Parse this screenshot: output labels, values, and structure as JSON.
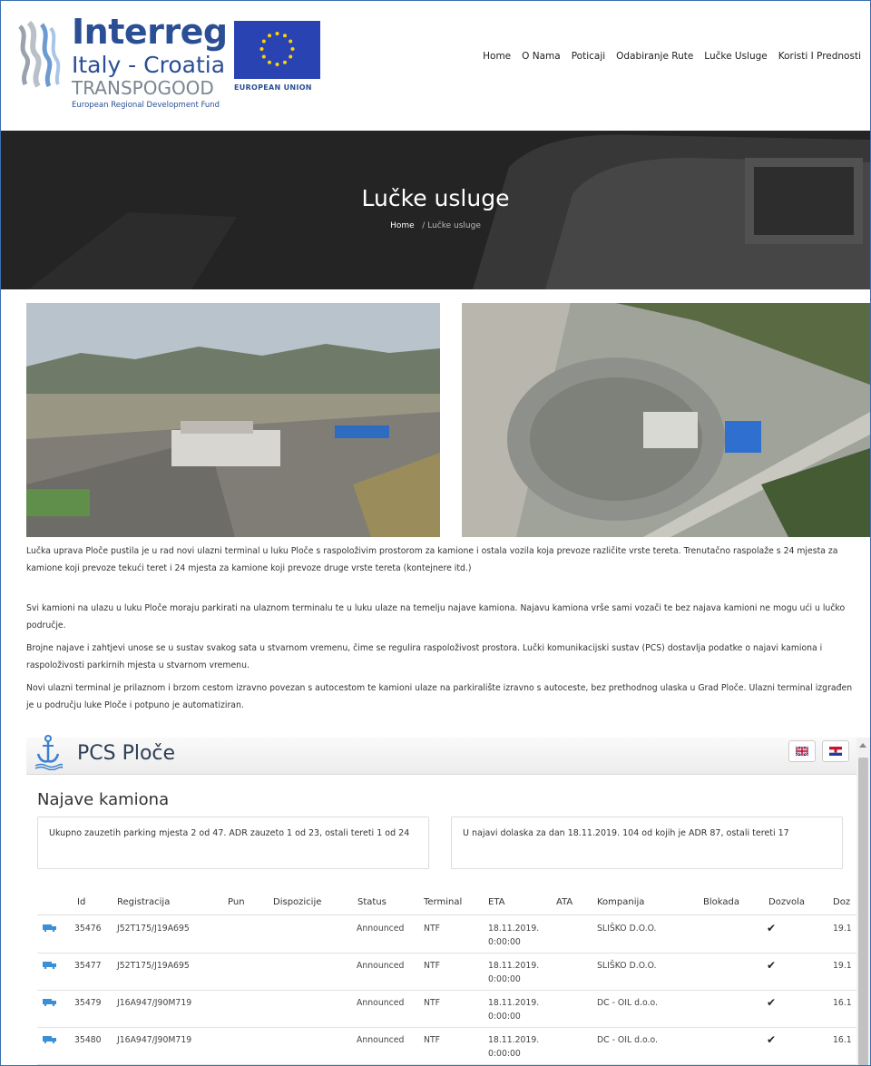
{
  "header": {
    "logo_main": "Interreg",
    "logo_country": "Italy - Croatia",
    "logo_project": "TRANSPOGOOD",
    "logo_fund": "European Regional Development Fund",
    "eu_label": "EUROPEAN UNION",
    "nav": [
      "Home",
      "O Nama",
      "Poticaji",
      "Odabiranje Rute",
      "Lučke Usluge",
      "Koristi I Prednosti"
    ]
  },
  "hero": {
    "title": "Lučke usluge",
    "breadcrumb_home": "Home",
    "breadcrumb_sep": "/",
    "breadcrumb_current": "Lučke usluge"
  },
  "content": {
    "paragraphs": [
      "Lučka uprava Ploče pustila je u rad novi ulazni terminal u luku Ploče s raspoloživim prostorom za kamione i ostala vozila koja prevoze različite vrste tereta. Trenutačno raspolaže s 24 mjesta za kamione koji prevoze tekući teret i 24 mjesta za kamione koji prevoze druge vrste tereta (kontejnere itd.)",
      "Svi kamioni na ulazu u luku Ploče moraju parkirati na ulaznom terminalu te u luku ulaze na temelju najave kamiona. Najavu kamiona vrše sami vozači te bez najava kamioni ne mogu ući u lučko područje.",
      "Brojne najave i zahtjevi unose se u sustav svakog sata u stvarnom vremenu, čime se regulira raspoloživost prostora. Lučki komunikacijski sustav (PCS) dostavlja podatke o najavi kamiona i raspoloživosti parkirnih mjesta u stvarnom vremenu.",
      "Novi ulazni terminal je prilaznom i brzom cestom izravno povezan s autocestom te kamioni ulaze na parkiralište izravno s autoceste, bez prethodnog ulaska u Grad Ploče. Ulazni terminal izgrađen je u području luke Ploče i potpuno je automatiziran."
    ]
  },
  "pcs": {
    "title": "PCS Ploče",
    "section_title": "Najave kamiona",
    "info_left": "Ukupno zauzetih parking mjesta 2 od 47. ADR zauzeto 1 od 23, ostali tereti 1 od 24",
    "info_right": "U najavi dolaska za dan 18.11.2019. 104 od kojih je ADR 87, ostali tereti 17",
    "columns": [
      "Id",
      "Registracija",
      "Pun",
      "Dispozicije",
      "Status",
      "Terminal",
      "ETA",
      "ATA",
      "Kompanija",
      "Blokada",
      "Dozvola",
      "Doz"
    ],
    "rows": [
      {
        "id": "35476",
        "reg": "J52T175/J19A695",
        "status": "Announced",
        "terminal": "NTF",
        "eta_date": "18.11.2019.",
        "eta_time": "0:00:00",
        "company": "SLIŠKO D.O.O.",
        "check": "✔",
        "doz": "19.1"
      },
      {
        "id": "35477",
        "reg": "J52T175/J19A695",
        "status": "Announced",
        "terminal": "NTF",
        "eta_date": "18.11.2019.",
        "eta_time": "0:00:00",
        "company": "SLIŠKO D.O.O.",
        "check": "✔",
        "doz": "19.1"
      },
      {
        "id": "35479",
        "reg": "J16A947/J90M719",
        "status": "Announced",
        "terminal": "NTF",
        "eta_date": "18.11.2019.",
        "eta_time": "0:00:00",
        "company": "DC - OIL d.o.o.",
        "check": "✔",
        "doz": "16.1"
      },
      {
        "id": "35480",
        "reg": "J16A947/J90M719",
        "status": "Announced",
        "terminal": "NTF",
        "eta_date": "18.11.2019.",
        "eta_time": "0:00:00",
        "company": "DC - OIL d.o.o.",
        "check": "✔",
        "doz": "16.1"
      }
    ]
  },
  "colors": {
    "brand_blue": "#2a4f95",
    "eu_blue": "#2a43b2",
    "truck_icon": "#3a8fd6"
  }
}
